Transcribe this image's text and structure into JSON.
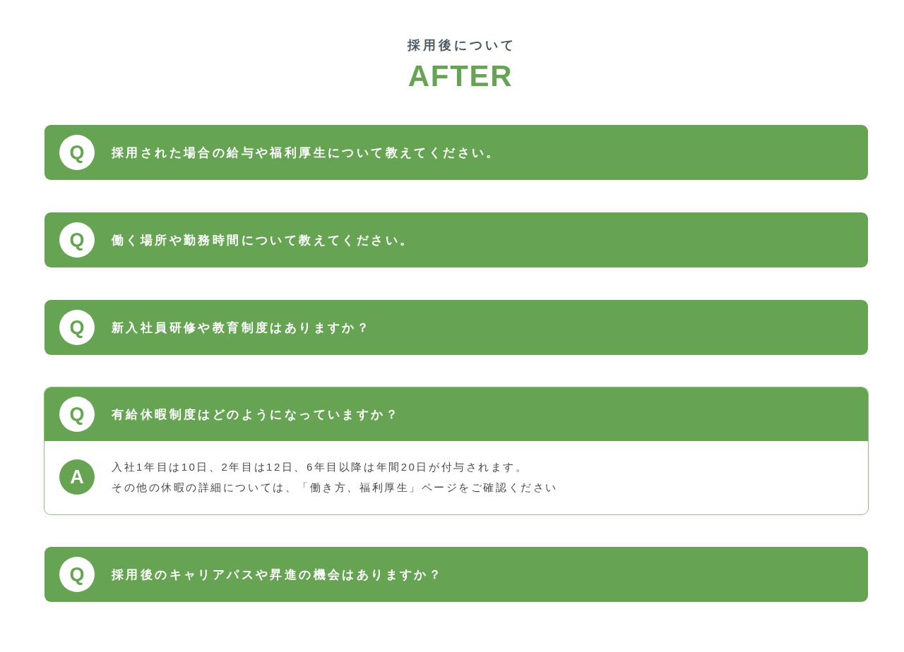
{
  "section": {
    "subtitle": "採用後について",
    "title": "AFTER"
  },
  "faq": [
    {
      "mark": "Q",
      "question": "採用された場合の給与や福利厚生について教えてください。",
      "expanded": false
    },
    {
      "mark": "Q",
      "question": "働く場所や勤務時間について教えてください。",
      "expanded": false
    },
    {
      "mark": "Q",
      "question": "新入社員研修や教育制度はありますか？",
      "expanded": false
    },
    {
      "mark": "Q",
      "question": "有給休暇制度はどのようになっていますか？",
      "expanded": true,
      "answer": {
        "mark": "A",
        "lines": [
          "入社1年目は10日、2年目は12日、6年目以降は年間20日が付与されます。",
          "その他の休暇の詳細については、「働き方、福利厚生」ページをご確認ください"
        ]
      }
    },
    {
      "mark": "Q",
      "question": "採用後のキャリアパスや昇進の機会はありますか？",
      "expanded": false
    }
  ]
}
